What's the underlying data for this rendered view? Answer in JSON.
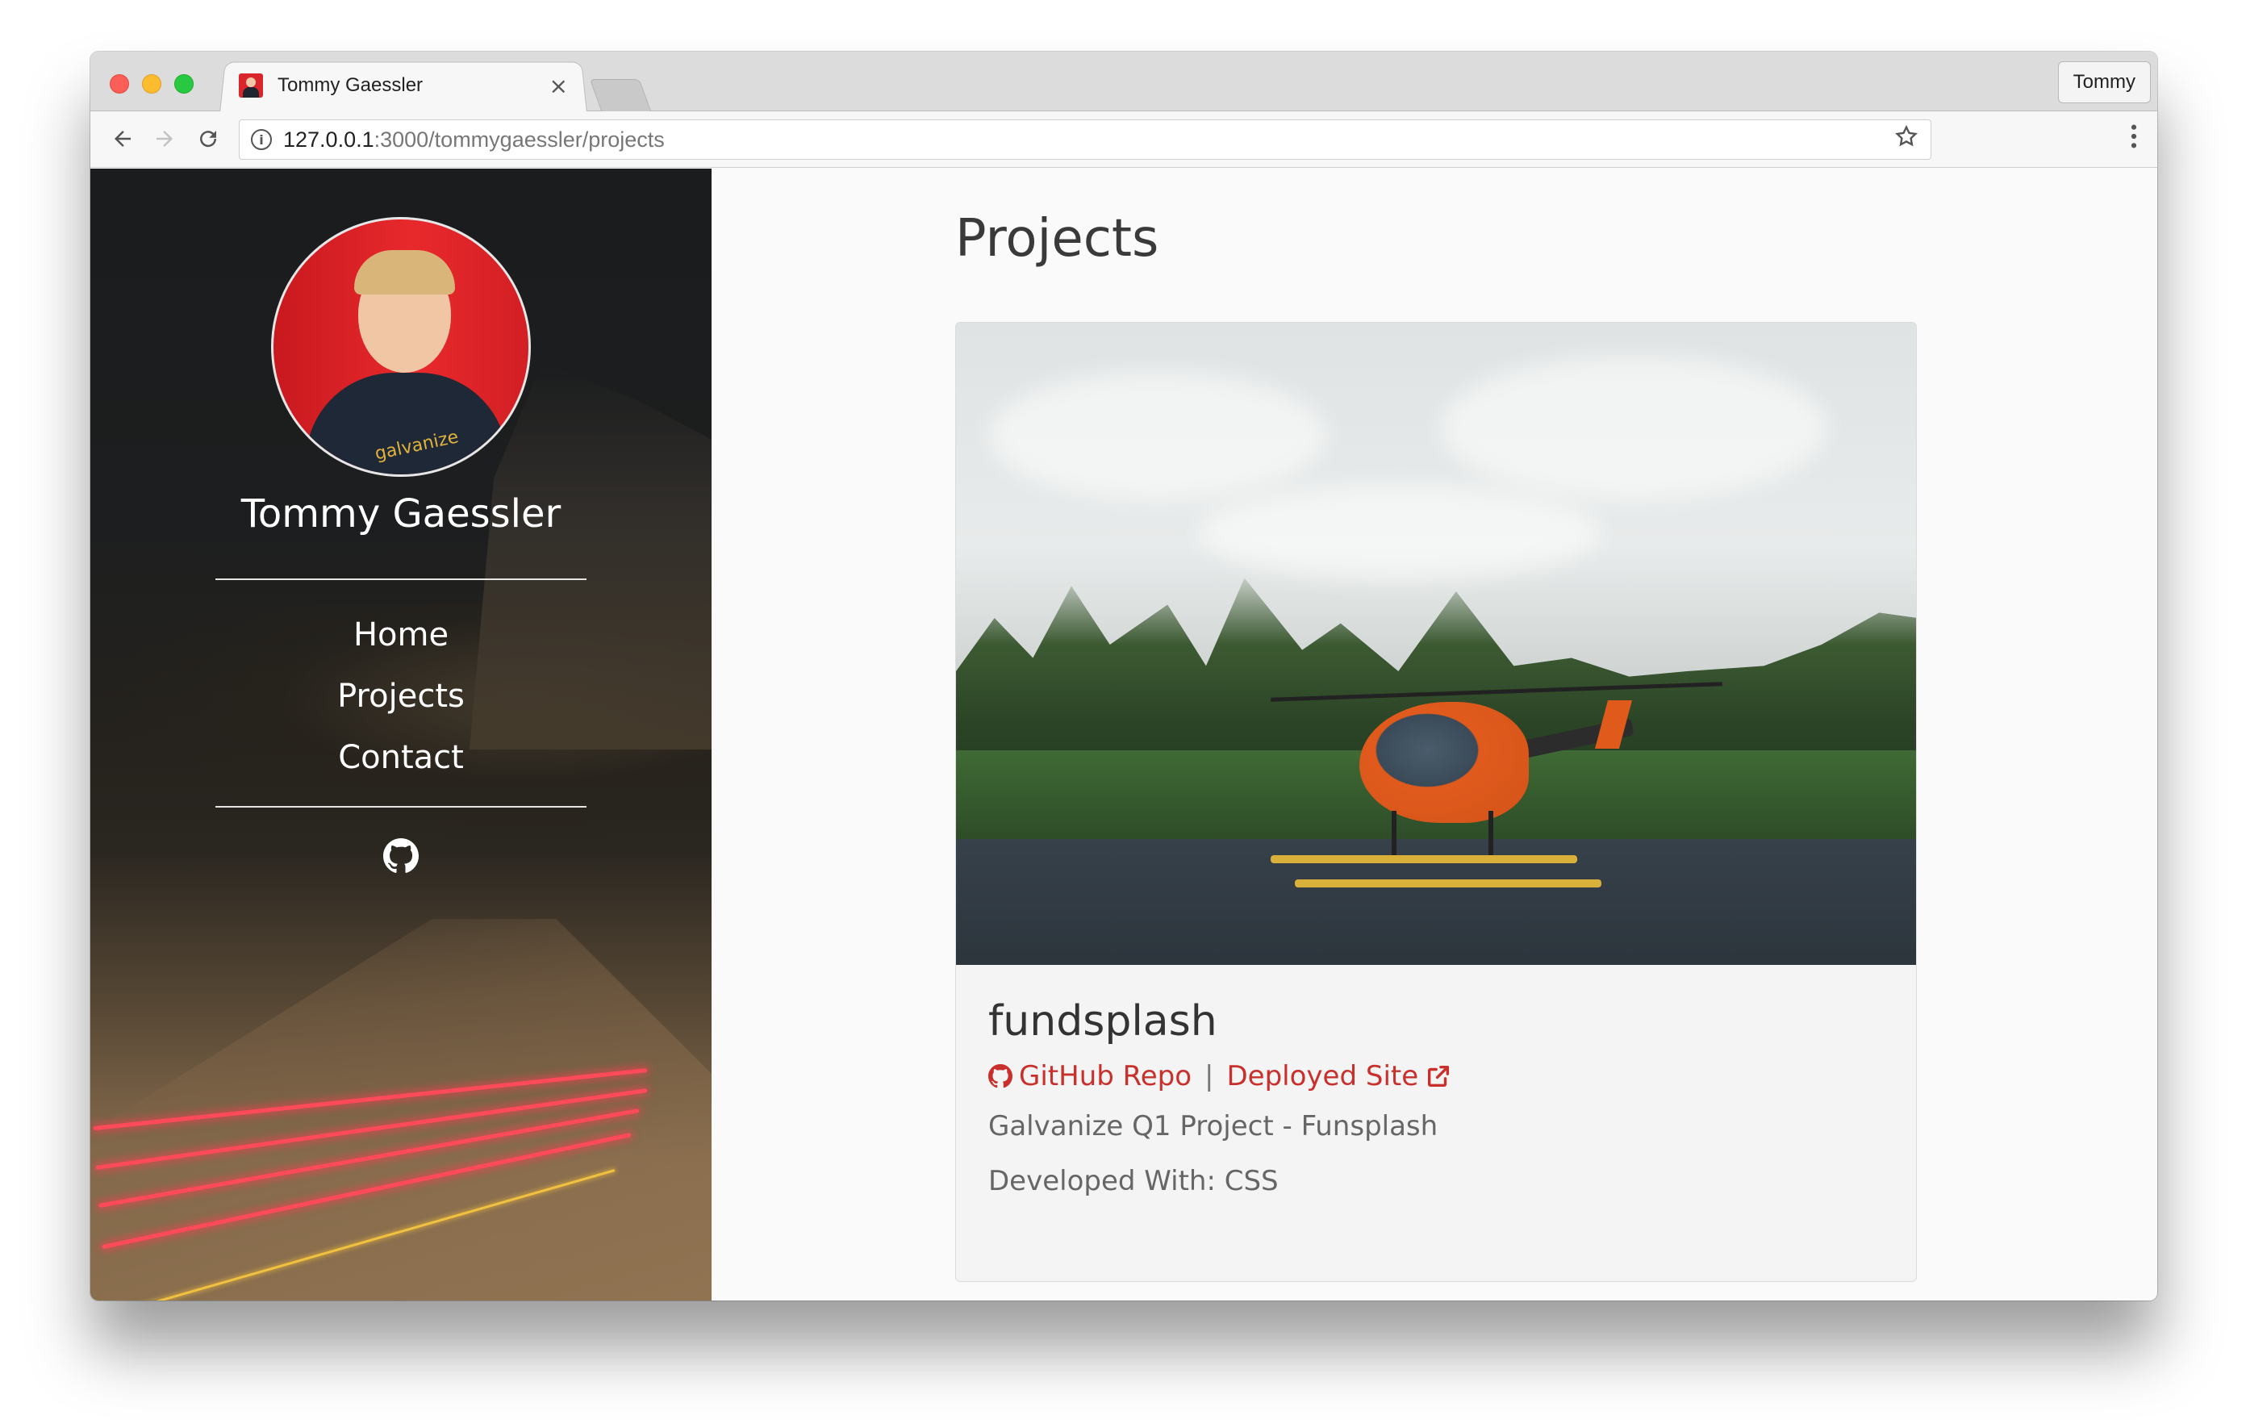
{
  "browser": {
    "tab_title": "Tommy Gaessler",
    "tab_close": "×",
    "profile_name": "Tommy",
    "url_host": "127.0.0.1",
    "url_rest": ":3000/tommygaessler/projects",
    "info_icon": "i"
  },
  "sidebar": {
    "name": "Tommy Gaessler",
    "avatar_shirt_text": "galvanize",
    "nav": [
      {
        "label": "Home"
      },
      {
        "label": "Projects"
      },
      {
        "label": "Contact"
      }
    ],
    "social_icon": "github-icon"
  },
  "main": {
    "title": "Projects",
    "projects": [
      {
        "name": "fundsplash",
        "github_label": "GitHub Repo",
        "separator": "|",
        "deployed_label": "Deployed Site",
        "description": "Galvanize Q1 Project - Funsplash",
        "developed_with": "Developed With: CSS"
      }
    ]
  },
  "colors": {
    "link": "#c9302c",
    "sidebar_bg": "#1c1e1f",
    "page_bg": "#fafafa",
    "card_bg": "#f4f4f4"
  }
}
